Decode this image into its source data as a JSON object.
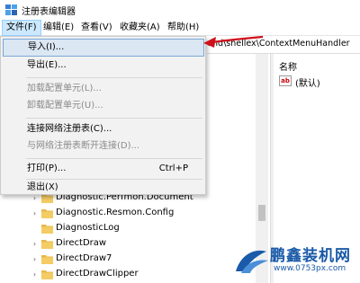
{
  "window": {
    "title": "注册表编辑器"
  },
  "menubar": {
    "items": [
      "文件(F)",
      "编辑(E)",
      "查看(V)",
      "收藏夹(A)",
      "帮助(H)"
    ]
  },
  "address": {
    "text": "und\\shellex\\ContextMenuHandler"
  },
  "file_menu": {
    "items": [
      {
        "label": "导入(I)...",
        "shortcut": "",
        "state": "highlighted"
      },
      {
        "label": "导出(E)...",
        "shortcut": "",
        "state": "enabled"
      },
      {
        "label": "加载配置单元(L)...",
        "shortcut": "",
        "state": "disabled"
      },
      {
        "label": "卸载配置单元(U)...",
        "shortcut": "",
        "state": "disabled"
      },
      {
        "label": "连接网络注册表(C)...",
        "shortcut": "",
        "state": "enabled"
      },
      {
        "label": "与网络注册表断开连接(D)...",
        "shortcut": "",
        "state": "disabled"
      },
      {
        "label": "打印(P)...",
        "shortcut": "Ctrl+P",
        "state": "enabled"
      },
      {
        "label": "退出(X)",
        "shortcut": "",
        "state": "enabled"
      }
    ]
  },
  "tree": {
    "rows": [
      {
        "label": "Diagnostic.Perfmon.Document",
        "expander": "›"
      },
      {
        "label": "Diagnostic.Resmon.Config",
        "expander": "›"
      },
      {
        "label": "DiagnosticLog",
        "expander": ""
      },
      {
        "label": "DirectDraw",
        "expander": "›"
      },
      {
        "label": "DirectDraw7",
        "expander": "›"
      },
      {
        "label": "DirectDrawClipper",
        "expander": "›"
      }
    ]
  },
  "values_pane": {
    "column_header": "名称",
    "rows": [
      {
        "icon": "ab",
        "name": "(默认)"
      }
    ]
  },
  "watermark": {
    "title": "鹏鑫装机网",
    "url": "www.0753px.com"
  },
  "colors": {
    "highlight_bg": "#dbe7f3",
    "highlight_border": "#7aa7d6",
    "menu_active_bg": "#cce8ff",
    "folder": "#e8b84a",
    "arrow": "#d0101a",
    "brand": "#1a5aa8"
  }
}
